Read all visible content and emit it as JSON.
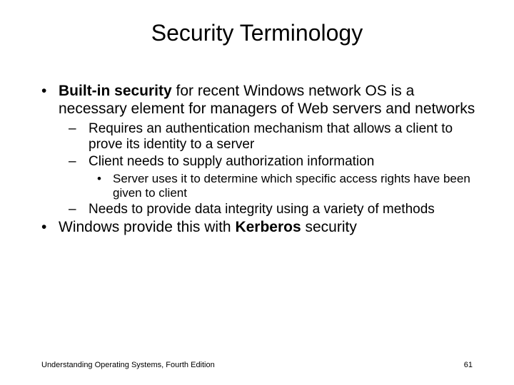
{
  "title": "Security Terminology",
  "bullets": {
    "b1_bold": "Built-in security",
    "b1_rest": " for recent Windows network OS is a necessary element for managers of Web servers and networks",
    "b1a": "Requires an authentication mechanism that allows a client to prove its identity to a server",
    "b1b": "Client needs to supply authorization information",
    "b1b1": "Server uses it to determine which specific access rights have been given to client",
    "b1c": "Needs to provide data integrity using a variety of methods",
    "b2_pre": "Windows provide this with ",
    "b2_bold": "Kerberos",
    "b2_post": " security"
  },
  "footer": {
    "left": "Understanding Operating Systems, Fourth Edition",
    "right": "61"
  }
}
